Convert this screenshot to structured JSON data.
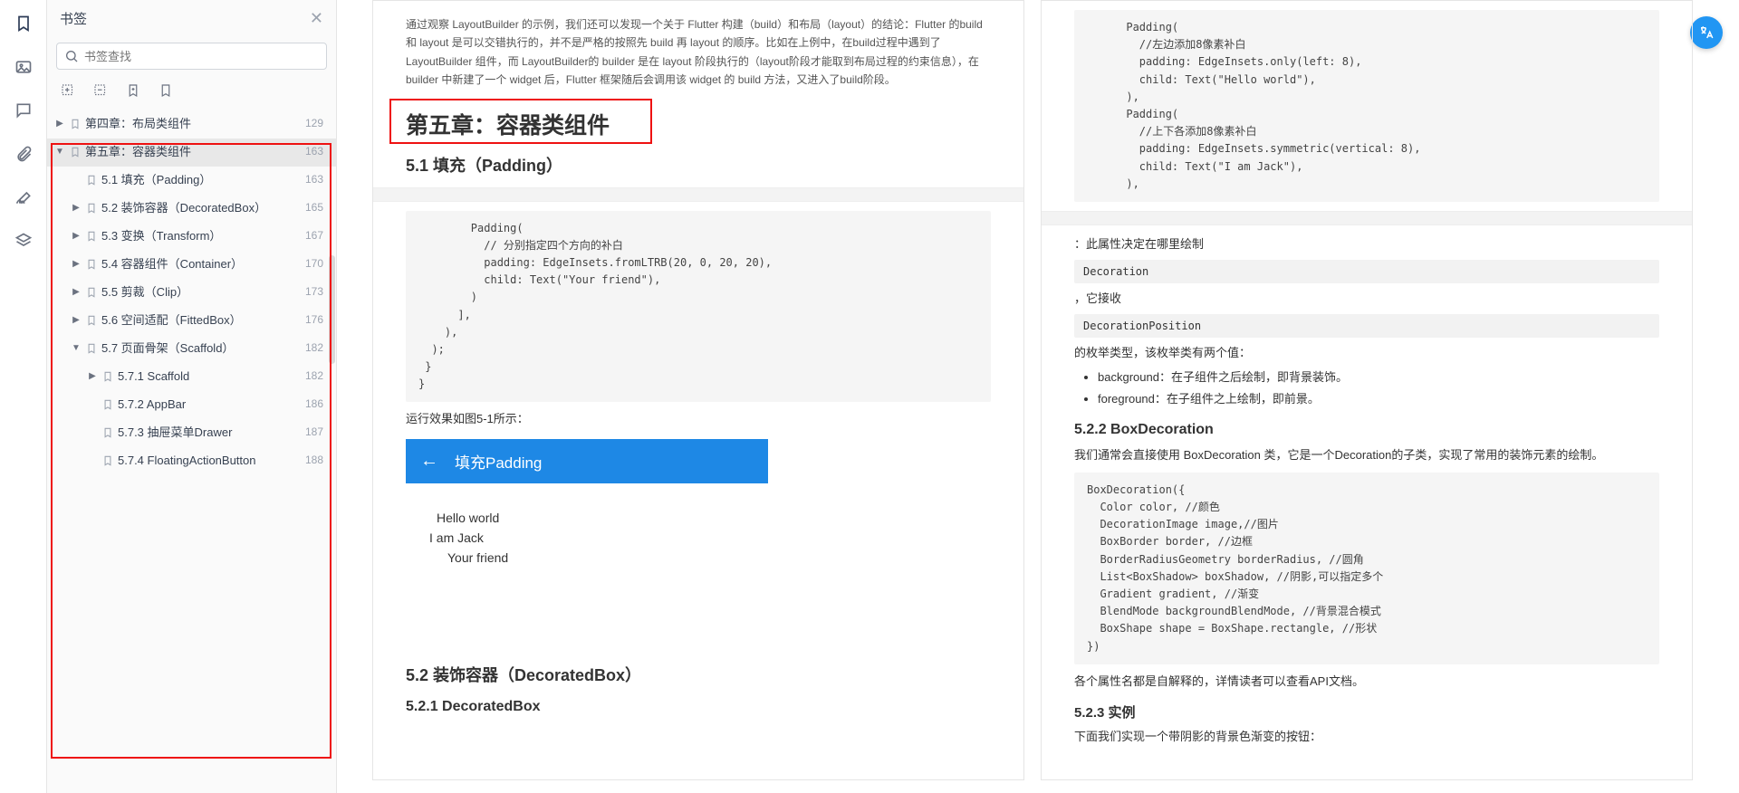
{
  "sidebar": {
    "icons": [
      {
        "name": "bookmark-icon",
        "active": true
      },
      {
        "name": "image-icon"
      },
      {
        "name": "comment-icon"
      },
      {
        "name": "attachment-icon"
      },
      {
        "name": "signature-icon"
      },
      {
        "name": "layers-icon"
      }
    ]
  },
  "panel": {
    "title": "书签",
    "search_placeholder": "书签查找",
    "tools": [
      "expand-add-icon",
      "collapse-icon",
      "bookmark-add-icon",
      "bookmark-outline-icon"
    ],
    "tree": [
      {
        "depth": 0,
        "caret": "▶",
        "label": "第四章：布局类组件",
        "page": "129"
      },
      {
        "depth": 0,
        "caret": "▼",
        "label": "第五章：容器类组件",
        "page": "163",
        "selected": true
      },
      {
        "depth": 1,
        "caret": "",
        "label": "5.1 填充（Padding）",
        "page": "163"
      },
      {
        "depth": 1,
        "caret": "▶",
        "label": "5.2 装饰容器（DecoratedBox）",
        "page": "165"
      },
      {
        "depth": 1,
        "caret": "▶",
        "label": "5.3 变换（Transform）",
        "page": "167"
      },
      {
        "depth": 1,
        "caret": "▶",
        "label": "5.4 容器组件（Container）",
        "page": "170"
      },
      {
        "depth": 1,
        "caret": "▶",
        "label": "5.5 剪裁（Clip）",
        "page": "173"
      },
      {
        "depth": 1,
        "caret": "▶",
        "label": "5.6 空间适配（FittedBox）",
        "page": "176"
      },
      {
        "depth": 1,
        "caret": "▼",
        "label": "5.7 页面骨架（Scaffold）",
        "page": "182"
      },
      {
        "depth": 2,
        "caret": "▶",
        "label": "5.7.1 Scaffold",
        "page": "182"
      },
      {
        "depth": 2,
        "caret": "",
        "label": "5.7.2 AppBar",
        "page": "186"
      },
      {
        "depth": 2,
        "caret": "",
        "label": "5.7.3 抽屉菜单Drawer",
        "page": "187"
      },
      {
        "depth": 2,
        "caret": "",
        "label": "5.7.4 FloatingActionButton",
        "page": "188"
      }
    ]
  },
  "doc": {
    "left_top_para1": "通过观察 LayoutBuilder 的示例，我们还可以发现一个关于 Flutter 构建（build）和布局（layout）的结论：Flutter 的build 和 layout 是可以交错执行的，并不是严格的按照先 build 再 layout 的顺序。比如在上例中，在build过程中遇到了 LayoutBuilder 组件，而 LayoutBuilder的 builder 是在 layout 阶段执行的（layout阶段才能取到布局过程的约束信息），在 builder 中新建了一个 widget 后，Flutter 框架随后会调用该 widget 的 build 方法，又进入了build阶段。",
    "chapter_heading": "第五章：容器类组件",
    "sec_5_1": "5.1 填充（Padding）",
    "code_padding": "        Padding(\n          // 分别指定四个方向的补白\n          padding: EdgeInsets.fromLTRB(20, 0, 20, 20),\n          child: Text(\"Your friend\"),\n        )\n      ],\n    ),\n  );\n }\n}",
    "run_caption": "运行效果如图5-1所示：",
    "appbar_title": "填充Padding",
    "shot_l1": "Hello world",
    "shot_l2": "I am Jack",
    "shot_l3": "Your friend",
    "sec_5_2": "5.2 装饰容器（DecoratedBox）",
    "sec_5_2_1": "5.2.1 DecoratedBox",
    "right_code_top": "      Padding(\n        //左边添加8像素补白\n        padding: EdgeInsets.only(left: 8),\n        child: Text(\"Hello world\"),\n      ),\n      Padding(\n        //上下各添加8像素补白\n        padding: EdgeInsets.symmetric(vertical: 8),\n        child: Text(\"I am Jack\"),\n      ),",
    "right_p1": "：此属性决定在哪里绘制",
    "right_chip1": "Decoration",
    "right_p2": "，它接收",
    "right_chip2": "DecorationPosition",
    "right_p3": "的枚举类型，该枚举类有两个值：",
    "right_bul1": "background：在子组件之后绘制，即背景装饰。",
    "right_bul2": "foreground：在子组件之上绘制，即前景。",
    "sec_5_2_2": "5.2.2 BoxDecoration",
    "right_p4": "我们通常会直接使用 BoxDecoration 类，它是一个Decoration的子类，实现了常用的装饰元素的绘制。",
    "right_code_mid": "BoxDecoration({\n  Color color, //颜色\n  DecorationImage image,//图片\n  BoxBorder border, //边框\n  BorderRadiusGeometry borderRadius, //圆角\n  List<BoxShadow> boxShadow, //阴影,可以指定多个\n  Gradient gradient, //渐变\n  BlendMode backgroundBlendMode, //背景混合模式\n  BoxShape shape = BoxShape.rectangle, //形状\n})",
    "right_p5": "各个属性名都是自解释的，详情读者可以查看API文档。",
    "sec_5_2_3": "5.2.3 实例",
    "right_p6": "下面我们实现一个带阴影的背景色渐变的按钮："
  }
}
